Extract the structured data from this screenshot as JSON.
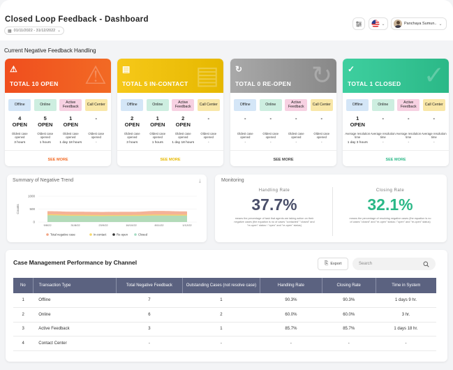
{
  "header": {
    "title": "Closed Loop Feedback - Dashboard",
    "date_range": "01/11/2022 - 31/12/2022",
    "user_name": "Panchaya Sumun.."
  },
  "section_label": "Current Negative Feedback Handling",
  "cards": [
    {
      "total": "TOTAL 10 OPEN",
      "color": "#f04e1e",
      "accent": "#f26a24",
      "icon": "warning-icon",
      "cols": [
        {
          "chip": "Offline",
          "chip_color": "#d4e6f7",
          "value": "4\nOPEN",
          "sub1": "Oldest case opened",
          "sub2": "3 hours"
        },
        {
          "chip": "Online",
          "chip_color": "#cdeee0",
          "value": "5\nOPEN",
          "sub1": "Oldest case opened",
          "sub2": "1 hours"
        },
        {
          "chip": "Active Feedback",
          "chip_color": "#f7d1e2",
          "value": "1\nOPEN",
          "sub1": "Oldest case opened",
          "sub2": "1 day 18 hours"
        },
        {
          "chip": "Call Center",
          "chip_color": "#f9e7a8",
          "value": "-",
          "sub1": "Oldest case opened",
          "sub2": "-"
        }
      ],
      "see_more": "SEE MORE",
      "see_more_color": "#f26a24"
    },
    {
      "total": "TOTAL 5 IN-CONTACT",
      "color": "#f6c819",
      "accent": "#e6b800",
      "icon": "chat-icon",
      "cols": [
        {
          "chip": "Offline",
          "chip_color": "#d4e6f7",
          "value": "2\nOPEN",
          "sub1": "Oldest case opened",
          "sub2": "3 hours"
        },
        {
          "chip": "Online",
          "chip_color": "#cdeee0",
          "value": "1\nOPEN",
          "sub1": "Oldest case opened",
          "sub2": "1 hours"
        },
        {
          "chip": "Active Feedback",
          "chip_color": "#f7d1e2",
          "value": "2\nOPEN",
          "sub1": "Oldest case opened",
          "sub2": "1 day 18 hours"
        },
        {
          "chip": "Call Center",
          "chip_color": "#f9e7a8",
          "value": "-",
          "sub1": "Oldest case opened",
          "sub2": "-"
        }
      ],
      "see_more": "SEE MORE",
      "see_more_color": "#e6b800"
    },
    {
      "total": "TOTAL 0 RE-OPEN",
      "color": "#a9a9a9",
      "accent": "#888888",
      "icon": "refresh-icon",
      "cols": [
        {
          "chip": "Offline",
          "chip_color": "#d4e6f7",
          "value": "-",
          "sub1": "Oldest case opened",
          "sub2": "-"
        },
        {
          "chip": "Online",
          "chip_color": "#cdeee0",
          "value": "-",
          "sub1": "Oldest case opened",
          "sub2": "-"
        },
        {
          "chip": "Active Feedback",
          "chip_color": "#f7d1e2",
          "value": "-",
          "sub1": "Oldest case opened",
          "sub2": "-"
        },
        {
          "chip": "Call Center",
          "chip_color": "#f9e7a8",
          "value": "-",
          "sub1": "Oldest case opened",
          "sub2": "-"
        }
      ],
      "see_more": "SEE MORE",
      "see_more_color": "#444444"
    },
    {
      "total": "TOTAL 1 CLOSED",
      "color": "#3ecf9f",
      "accent": "#2bb887",
      "icon": "check-icon",
      "cols": [
        {
          "chip": "Offline",
          "chip_color": "#d4e6f7",
          "value": "1\nOPEN",
          "sub1": "Average resolution time",
          "sub2": "1 day 3 hours"
        },
        {
          "chip": "Online",
          "chip_color": "#cdeee0",
          "value": "-",
          "sub1": "Average resolution time",
          "sub2": "-"
        },
        {
          "chip": "Active Feedback",
          "chip_color": "#f7d1e2",
          "value": "-",
          "sub1": "Average resolution time",
          "sub2": "-"
        },
        {
          "chip": "Call Center",
          "chip_color": "#f9e7a8",
          "value": "-",
          "sub1": "Average resolution time",
          "sub2": "-"
        }
      ],
      "see_more": "SEE MORE",
      "see_more_color": "#2bb887"
    }
  ],
  "trend": {
    "title": "Summary of Negative Trend",
    "chart_data": {
      "type": "area",
      "ylabel": "Counts",
      "y_ticks": [
        "1000",
        "500",
        "0"
      ],
      "ylim": [
        0,
        1000
      ],
      "categories": [
        "9/8/22",
        "31/8/22",
        "23/9/22",
        "16/10/22",
        "8/11/22",
        "1/12/22"
      ],
      "series": [
        {
          "name": "Total negative case",
          "color": "#f2a585",
          "values": [
            420,
            400,
            390,
            395,
            430,
            410
          ]
        },
        {
          "name": "In-contact",
          "color": "#f6d86b",
          "values": [
            300,
            280,
            270,
            275,
            290,
            285
          ]
        },
        {
          "name": "Re-open",
          "color": "#333333",
          "values": [
            0,
            0,
            0,
            0,
            0,
            0
          ]
        },
        {
          "name": "Closed",
          "color": "#a6dcc4",
          "values": [
            260,
            240,
            230,
            235,
            250,
            245
          ]
        }
      ]
    }
  },
  "monitoring": {
    "title": "Monitoring",
    "handling_label": "Handling Rate",
    "handling_value": "37.7%",
    "handling_color": "#4a4f6a",
    "handling_desc": "means the percentage of task that agents are taking action on their negative cases (the equation is no of cases \"contacted\" \"closed\" and \"re-open\" status / \"open\" and \"re-open\" status)",
    "closing_label": "Closing Rate",
    "closing_value": "32.1%",
    "closing_color": "#2bb887",
    "closing_desc": "means the percentage of resolving negative cases (the equation is no of cases \"closed\" and \"re-open\" status / \"open\" and \"re-open\" status)"
  },
  "table": {
    "title": "Case Management Performance by Channel",
    "export_label": "Export",
    "search_placeholder": "Search",
    "headers": [
      "No",
      "Transaction Type",
      "Total Negative Feedback",
      "Outstanding Cases (not resolve case)",
      "Handling Rate",
      "Closing Rate",
      "Time in System"
    ],
    "rows": [
      [
        "1",
        "Offline",
        "7",
        "1",
        "90.3%",
        "90.3%",
        "1 days 9 hr."
      ],
      [
        "2",
        "Online",
        "6",
        "2",
        "60.0%",
        "60.0%",
        "3 hr."
      ],
      [
        "3",
        "Active Feedback",
        "3",
        "1",
        "85.7%",
        "85.7%",
        "1 days 18 hr."
      ],
      [
        "4",
        "Contact Center",
        "-",
        "-",
        "-",
        "-",
        "-"
      ]
    ]
  }
}
